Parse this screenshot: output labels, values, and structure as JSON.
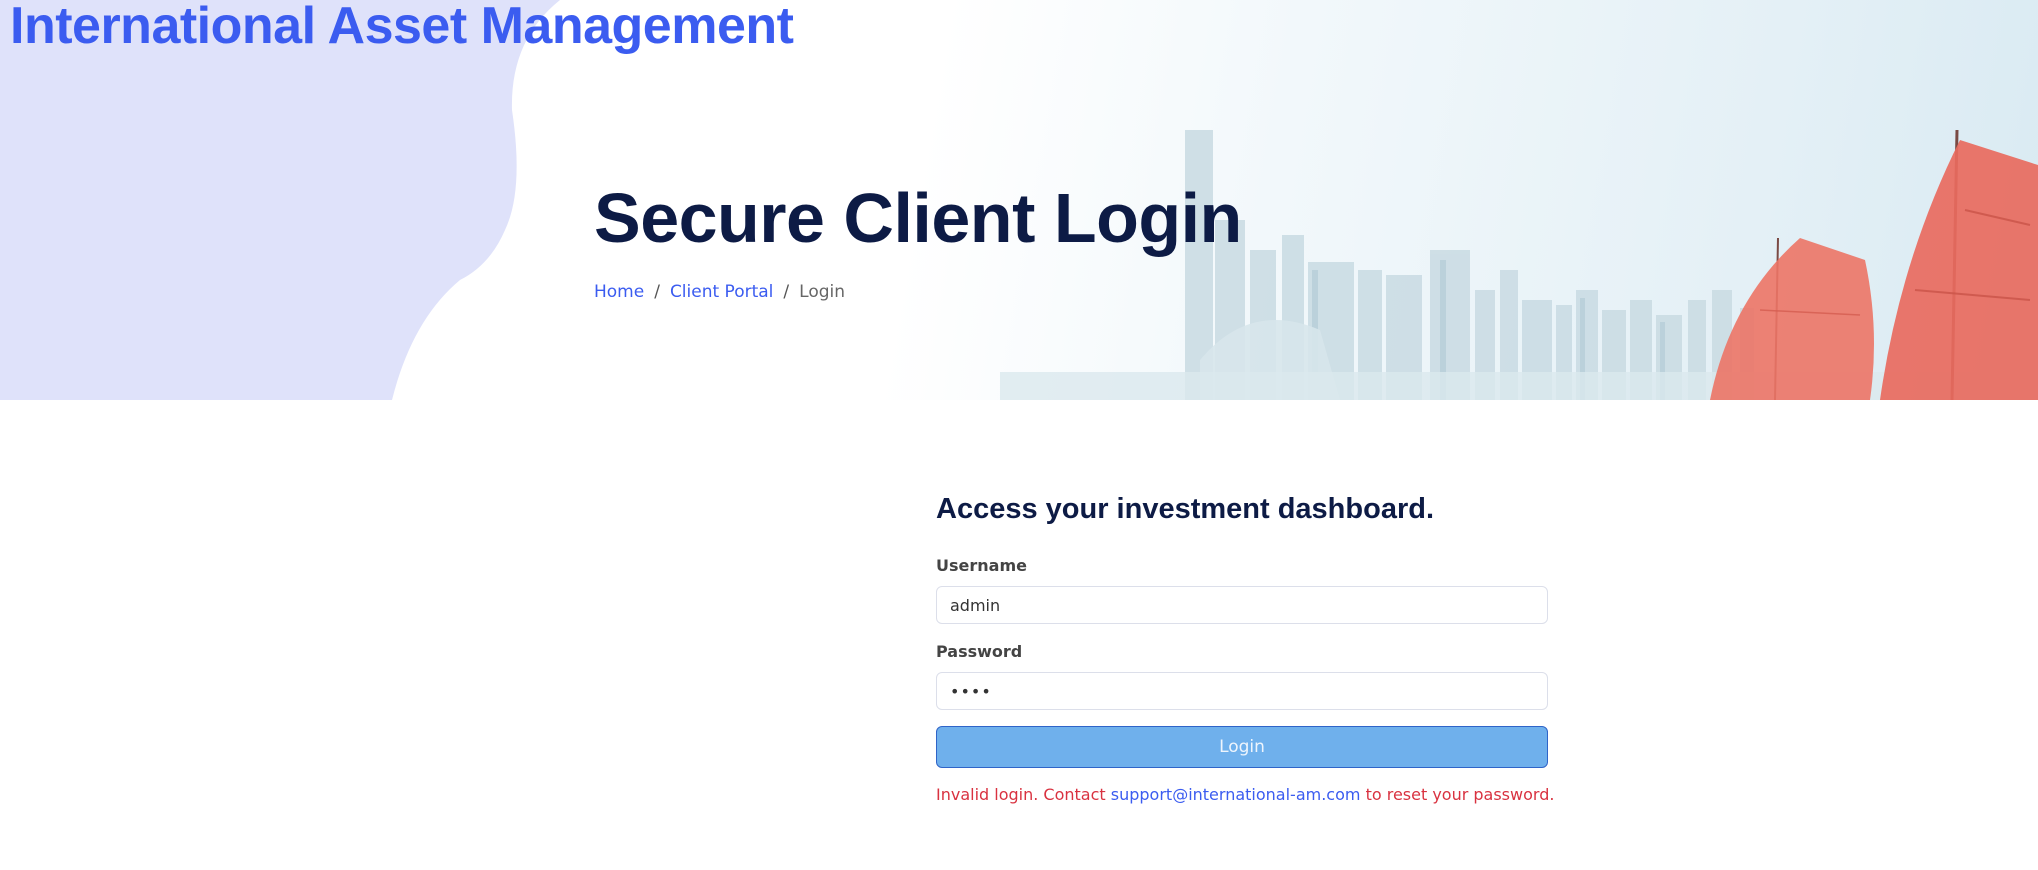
{
  "brand": {
    "name": "International Asset Management"
  },
  "hero": {
    "title": "Secure Client Login"
  },
  "breadcrumb": {
    "items": [
      {
        "label": "Home"
      },
      {
        "label": "Client Portal"
      },
      {
        "label": "Login"
      }
    ],
    "separator": "/"
  },
  "login_form": {
    "heading": "Access your investment dashboard.",
    "username_label": "Username",
    "username_value": "admin",
    "password_label": "Password",
    "password_value": "****",
    "submit_label": "Login",
    "error_prefix": "Invalid login. Contact",
    "support_email": "support@international-am.com",
    "error_suffix": "to reset your password."
  },
  "colors": {
    "brand_blue": "#3b5cf0",
    "heading_navy": "#0d1b45",
    "button_bg": "#6fb0ec",
    "error_red": "#d93240",
    "hero_blob": "#dfe2fa",
    "sail_red": "#e86a5e"
  }
}
